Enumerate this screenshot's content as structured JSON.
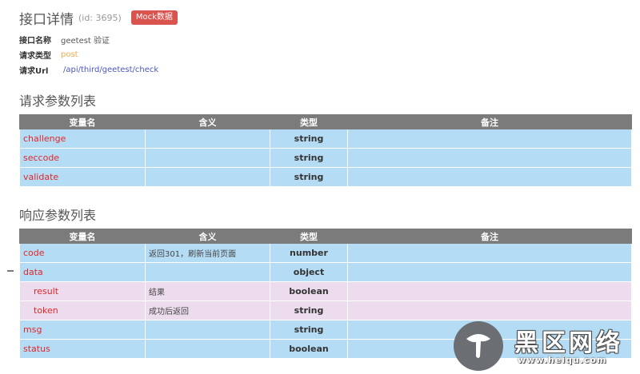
{
  "header": {
    "title": "接口详情",
    "id_text": "(id: 3695)",
    "mock_badge": "Mock数据"
  },
  "info": {
    "name_label": "接口名称",
    "name_value": "geetest 验证",
    "type_label": "请求类型",
    "type_value": "post",
    "url_label": "请求Url",
    "url_value": "/api/third/geetest/check"
  },
  "request_section": {
    "title": "请求参数列表",
    "columns": [
      "变量名",
      "含义",
      "类型",
      "备注"
    ],
    "rows": [
      {
        "name": "challenge",
        "desc": "",
        "type": "string",
        "note": ""
      },
      {
        "name": "seccode",
        "desc": "",
        "type": "string",
        "note": ""
      },
      {
        "name": "validate",
        "desc": "",
        "type": "string",
        "note": ""
      }
    ]
  },
  "response_section": {
    "title": "响应参数列表",
    "columns": [
      "变量名",
      "含义",
      "类型",
      "备注"
    ],
    "rows": [
      {
        "name": "code",
        "desc": "返回301，刷新当前页面",
        "type": "number",
        "note": ""
      },
      {
        "name": "data",
        "desc": "",
        "type": "object",
        "note": ""
      },
      {
        "name": "result",
        "desc": "结果",
        "type": "boolean",
        "note": ""
      },
      {
        "name": "token",
        "desc": "成功后返回",
        "type": "string",
        "note": ""
      },
      {
        "name": "msg",
        "desc": "",
        "type": "string",
        "note": ""
      },
      {
        "name": "status",
        "desc": "",
        "type": "boolean",
        "note": ""
      }
    ]
  },
  "watermark": {
    "text": "黑区网络",
    "url": "www.heiqu.com"
  },
  "colors": {
    "header_bg": "#7b7b7b",
    "row_bg": "#b5dcf5",
    "child_row_bg": "#eddcee",
    "name_color": "#e0282a",
    "badge_bg": "#d9534f",
    "post_color": "#f0ad4e",
    "url_color": "#4a56c8"
  }
}
